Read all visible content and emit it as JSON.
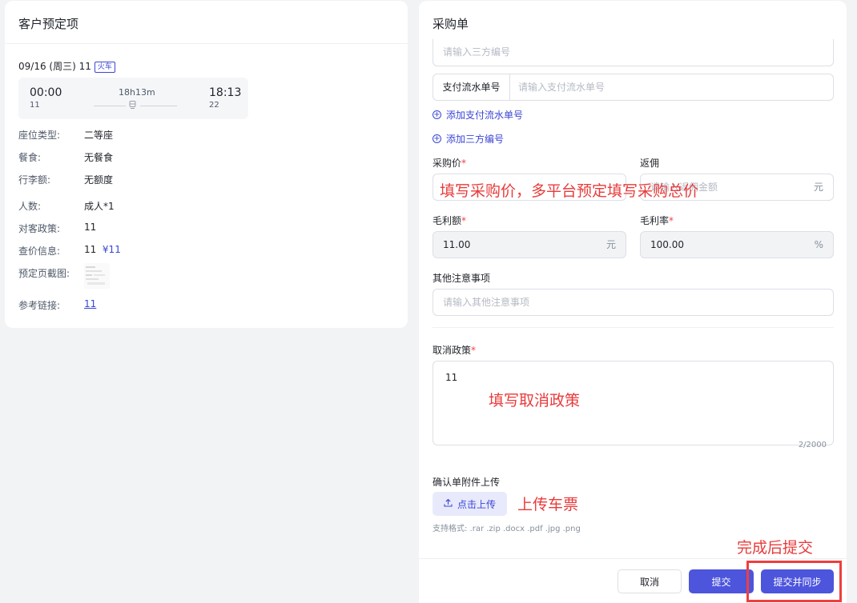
{
  "left": {
    "title": "客户预定项",
    "trip_line": "09/16 (周三) 11",
    "trip_tag": "火车",
    "depart_time": "00:00",
    "depart_station": "11",
    "duration": "18h13m",
    "arrive_time": "18:13",
    "arrive_station": "22",
    "rows": [
      {
        "label": "座位类型:",
        "value": "二等座"
      },
      {
        "label": "餐食:",
        "value": "无餐食"
      },
      {
        "label": "行李额:",
        "value": "无额度"
      },
      {
        "label": "人数:",
        "value": "成人*1"
      },
      {
        "label": "对客政策:",
        "value": "11"
      },
      {
        "label": "查价信息:",
        "value": "11",
        "extra": "¥11"
      },
      {
        "label": "预定页截图:",
        "value": ""
      },
      {
        "label": "参考链接:",
        "value": "11"
      }
    ]
  },
  "right": {
    "title": "采购单",
    "third_party_placeholder": "请输入三方编号",
    "pay_flow_label": "支付流水单号",
    "pay_flow_placeholder": "请输入支付流水单号",
    "add_pay_flow": "添加支付流水单号",
    "add_third_party": "添加三方编号",
    "purchase_price_label": "采购价",
    "rebate_label": "返佣",
    "rebate_placeholder": "请输入返佣金额",
    "rebate_unit": "元",
    "gross_profit_label": "毛利额",
    "gross_profit_value": "11.00",
    "gross_profit_unit": "元",
    "gross_margin_label": "毛利率",
    "gross_margin_value": "100.00",
    "gross_margin_unit": "%",
    "other_notes_label": "其他注意事项",
    "other_notes_placeholder": "请输入其他注意事项",
    "cancel_policy_label": "取消政策",
    "cancel_policy_value": "11",
    "cancel_policy_counter": "2/2000",
    "upload_label": "确认单附件上传",
    "upload_button": "点击上传",
    "upload_hint": "支持格式: .rar .zip .docx .pdf .jpg .png",
    "required_mark": "*"
  },
  "footer": {
    "cancel": "取消",
    "submit": "提交",
    "submit_sync": "提交并同步"
  },
  "annotations": {
    "price": "填写采购价，多平台预定填写采购总价",
    "cancel": "填写取消政策",
    "upload": "上传车票",
    "submit": "完成后提交"
  },
  "colors": {
    "accent": "#3b46d4",
    "annotation": "#e83b3b",
    "required": "#f53f3f"
  }
}
